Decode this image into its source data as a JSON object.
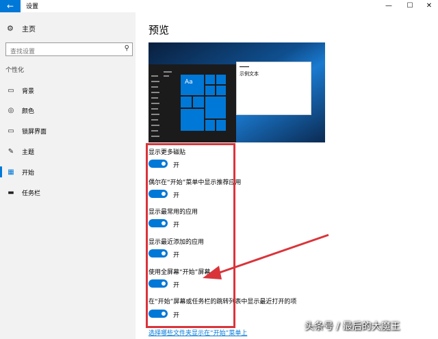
{
  "window": {
    "title": "设置",
    "back_glyph": "←",
    "minimize_glyph": "—",
    "maximize_glyph": "☐",
    "close_glyph": "✕"
  },
  "sidebar": {
    "home_label": "主页",
    "home_icon": "gear-icon",
    "search_placeholder": "查找设置",
    "search_icon": "search-icon",
    "section_label": "个性化",
    "items": [
      {
        "label": "背景",
        "icon": "picture-icon",
        "glyph": "▭",
        "active": false
      },
      {
        "label": "颜色",
        "icon": "palette-icon",
        "glyph": "◎",
        "active": false
      },
      {
        "label": "锁屏界面",
        "icon": "lock-screen-icon",
        "glyph": "▭",
        "active": false
      },
      {
        "label": "主题",
        "icon": "theme-brush-icon",
        "glyph": "✎",
        "active": false
      },
      {
        "label": "开始",
        "icon": "start-icon",
        "glyph": "▦",
        "active": true
      },
      {
        "label": "任务栏",
        "icon": "taskbar-icon",
        "glyph": "▬",
        "active": false
      }
    ]
  },
  "main": {
    "page_title": "预览",
    "preview": {
      "tile_text": "Aa",
      "sample_text": "示例文本"
    },
    "options": [
      {
        "label": "显示更多磁贴",
        "state": "开"
      },
      {
        "label": "偶尔在“开始”菜单中显示推荐应用",
        "state": "开"
      },
      {
        "label": "显示最常用的应用",
        "state": "开"
      },
      {
        "label": "显示最近添加的应用",
        "state": "开"
      },
      {
        "label": "使用全屏幕“开始”屏幕",
        "state": "开"
      },
      {
        "label": "在“开始”屏幕或任务栏的跳转列表中显示最近打开的项",
        "state": "开"
      }
    ],
    "bottom_link": "选择哪些文件夹显示在“开始”菜单上"
  },
  "annotation": {
    "color": "#d9343a"
  },
  "watermark": "头条号 / 最后的大魔王",
  "colors": {
    "accent": "#0078d7",
    "sidebar_bg": "#f2f2f2"
  }
}
